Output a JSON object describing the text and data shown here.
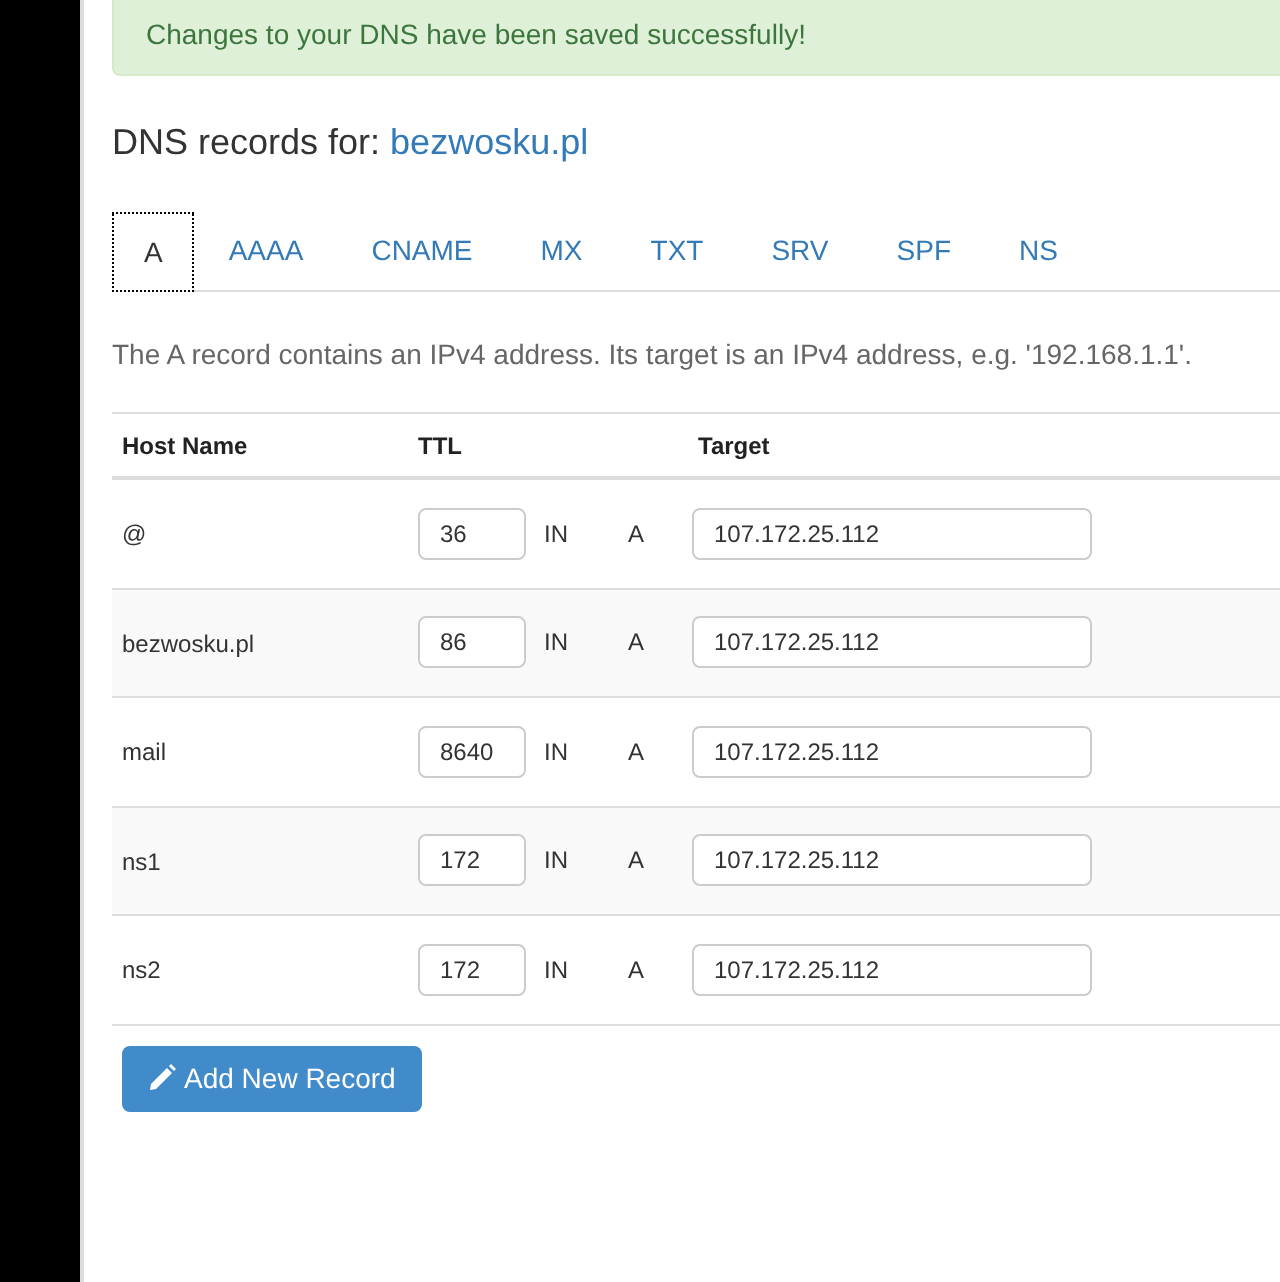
{
  "alert": {
    "message": "Changes to your DNS have been saved successfully!"
  },
  "heading": {
    "label": "DNS records for:",
    "domain": "bezwosku.pl"
  },
  "tabs": [
    {
      "label": "A",
      "selected": true
    },
    {
      "label": "AAAA",
      "selected": false
    },
    {
      "label": "CNAME",
      "selected": false
    },
    {
      "label": "MX",
      "selected": false
    },
    {
      "label": "TXT",
      "selected": false
    },
    {
      "label": "SRV",
      "selected": false
    },
    {
      "label": "SPF",
      "selected": false
    },
    {
      "label": "NS",
      "selected": false
    }
  ],
  "description": "The A record contains an IPv4 address. Its target is an IPv4 address, e.g. '192.168.1.1'.",
  "table": {
    "columns": [
      "Host Name",
      "TTL",
      "Target"
    ],
    "rows": [
      {
        "host": "@",
        "ttl": "36",
        "class": "IN",
        "type": "A",
        "target": "107.172.25.112"
      },
      {
        "host": "bezwosku.pl",
        "ttl": "86",
        "class": "IN",
        "type": "A",
        "target": "107.172.25.112"
      },
      {
        "host": "mail",
        "ttl": "8640",
        "class": "IN",
        "type": "A",
        "target": "107.172.25.112"
      },
      {
        "host": "ns1",
        "ttl": "172",
        "class": "IN",
        "type": "A",
        "target": "107.172.25.112"
      },
      {
        "host": "ns2",
        "ttl": "172",
        "class": "IN",
        "type": "A",
        "target": "107.172.25.112"
      }
    ]
  },
  "add_button": "Add New Record"
}
